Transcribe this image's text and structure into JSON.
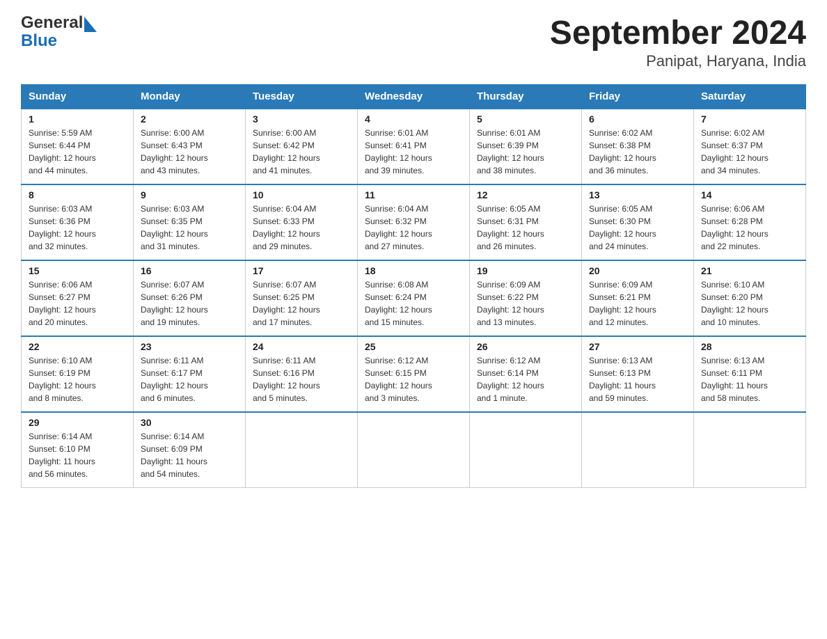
{
  "header": {
    "logo_general": "General",
    "logo_blue": "Blue",
    "title": "September 2024",
    "subtitle": "Panipat, Haryana, India"
  },
  "days_of_week": [
    "Sunday",
    "Monday",
    "Tuesday",
    "Wednesday",
    "Thursday",
    "Friday",
    "Saturday"
  ],
  "weeks": [
    [
      {
        "day": "1",
        "sunrise": "5:59 AM",
        "sunset": "6:44 PM",
        "daylight": "12 hours and 44 minutes."
      },
      {
        "day": "2",
        "sunrise": "6:00 AM",
        "sunset": "6:43 PM",
        "daylight": "12 hours and 43 minutes."
      },
      {
        "day": "3",
        "sunrise": "6:00 AM",
        "sunset": "6:42 PM",
        "daylight": "12 hours and 41 minutes."
      },
      {
        "day": "4",
        "sunrise": "6:01 AM",
        "sunset": "6:41 PM",
        "daylight": "12 hours and 39 minutes."
      },
      {
        "day": "5",
        "sunrise": "6:01 AM",
        "sunset": "6:39 PM",
        "daylight": "12 hours and 38 minutes."
      },
      {
        "day": "6",
        "sunrise": "6:02 AM",
        "sunset": "6:38 PM",
        "daylight": "12 hours and 36 minutes."
      },
      {
        "day": "7",
        "sunrise": "6:02 AM",
        "sunset": "6:37 PM",
        "daylight": "12 hours and 34 minutes."
      }
    ],
    [
      {
        "day": "8",
        "sunrise": "6:03 AM",
        "sunset": "6:36 PM",
        "daylight": "12 hours and 32 minutes."
      },
      {
        "day": "9",
        "sunrise": "6:03 AM",
        "sunset": "6:35 PM",
        "daylight": "12 hours and 31 minutes."
      },
      {
        "day": "10",
        "sunrise": "6:04 AM",
        "sunset": "6:33 PM",
        "daylight": "12 hours and 29 minutes."
      },
      {
        "day": "11",
        "sunrise": "6:04 AM",
        "sunset": "6:32 PM",
        "daylight": "12 hours and 27 minutes."
      },
      {
        "day": "12",
        "sunrise": "6:05 AM",
        "sunset": "6:31 PM",
        "daylight": "12 hours and 26 minutes."
      },
      {
        "day": "13",
        "sunrise": "6:05 AM",
        "sunset": "6:30 PM",
        "daylight": "12 hours and 24 minutes."
      },
      {
        "day": "14",
        "sunrise": "6:06 AM",
        "sunset": "6:28 PM",
        "daylight": "12 hours and 22 minutes."
      }
    ],
    [
      {
        "day": "15",
        "sunrise": "6:06 AM",
        "sunset": "6:27 PM",
        "daylight": "12 hours and 20 minutes."
      },
      {
        "day": "16",
        "sunrise": "6:07 AM",
        "sunset": "6:26 PM",
        "daylight": "12 hours and 19 minutes."
      },
      {
        "day": "17",
        "sunrise": "6:07 AM",
        "sunset": "6:25 PM",
        "daylight": "12 hours and 17 minutes."
      },
      {
        "day": "18",
        "sunrise": "6:08 AM",
        "sunset": "6:24 PM",
        "daylight": "12 hours and 15 minutes."
      },
      {
        "day": "19",
        "sunrise": "6:09 AM",
        "sunset": "6:22 PM",
        "daylight": "12 hours and 13 minutes."
      },
      {
        "day": "20",
        "sunrise": "6:09 AM",
        "sunset": "6:21 PM",
        "daylight": "12 hours and 12 minutes."
      },
      {
        "day": "21",
        "sunrise": "6:10 AM",
        "sunset": "6:20 PM",
        "daylight": "12 hours and 10 minutes."
      }
    ],
    [
      {
        "day": "22",
        "sunrise": "6:10 AM",
        "sunset": "6:19 PM",
        "daylight": "12 hours and 8 minutes."
      },
      {
        "day": "23",
        "sunrise": "6:11 AM",
        "sunset": "6:17 PM",
        "daylight": "12 hours and 6 minutes."
      },
      {
        "day": "24",
        "sunrise": "6:11 AM",
        "sunset": "6:16 PM",
        "daylight": "12 hours and 5 minutes."
      },
      {
        "day": "25",
        "sunrise": "6:12 AM",
        "sunset": "6:15 PM",
        "daylight": "12 hours and 3 minutes."
      },
      {
        "day": "26",
        "sunrise": "6:12 AM",
        "sunset": "6:14 PM",
        "daylight": "12 hours and 1 minute."
      },
      {
        "day": "27",
        "sunrise": "6:13 AM",
        "sunset": "6:13 PM",
        "daylight": "11 hours and 59 minutes."
      },
      {
        "day": "28",
        "sunrise": "6:13 AM",
        "sunset": "6:11 PM",
        "daylight": "11 hours and 58 minutes."
      }
    ],
    [
      {
        "day": "29",
        "sunrise": "6:14 AM",
        "sunset": "6:10 PM",
        "daylight": "11 hours and 56 minutes."
      },
      {
        "day": "30",
        "sunrise": "6:14 AM",
        "sunset": "6:09 PM",
        "daylight": "11 hours and 54 minutes."
      },
      null,
      null,
      null,
      null,
      null
    ]
  ],
  "labels": {
    "sunrise": "Sunrise:",
    "sunset": "Sunset:",
    "daylight": "Daylight:"
  }
}
